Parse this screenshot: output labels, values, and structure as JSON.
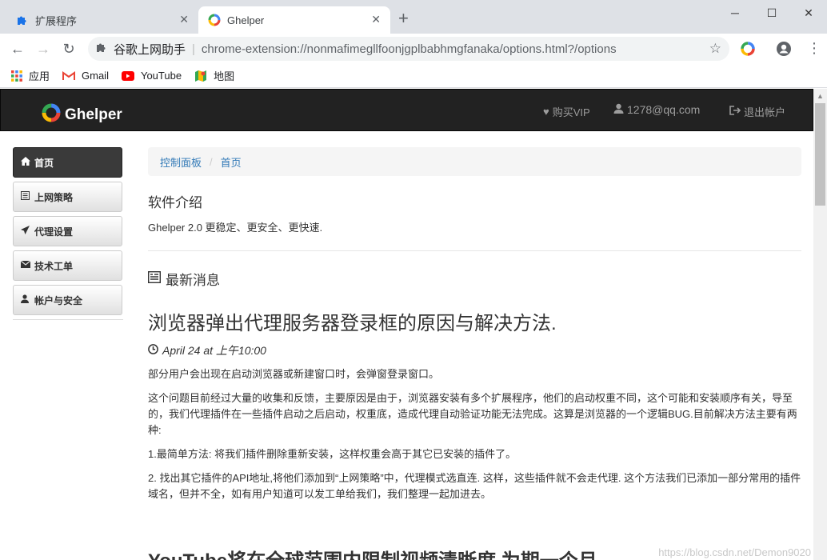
{
  "browser": {
    "tabs": [
      {
        "title": "扩展程序",
        "active": false
      },
      {
        "title": "Ghelper",
        "active": true
      }
    ],
    "omnibox": {
      "site_label": "谷歌上网助手",
      "url": "chrome-extension://nonmafimegllfoonjgplbabhmgfanaka/options.html?/options"
    },
    "bookmarks": [
      {
        "label": "应用",
        "icon": "apps-grid-icon"
      },
      {
        "label": "Gmail",
        "icon": "gmail-icon"
      },
      {
        "label": "YouTube",
        "icon": "youtube-icon"
      },
      {
        "label": "地图",
        "icon": "maps-icon"
      }
    ]
  },
  "navbar": {
    "brand": "Ghelper",
    "buy_vip": "购买VIP",
    "account": "1278@qq.com",
    "logout": "退出帐户"
  },
  "sidebar": {
    "items": [
      {
        "label": "首页",
        "icon": "home-icon",
        "active": true
      },
      {
        "label": "上网策略",
        "icon": "list-icon",
        "active": false
      },
      {
        "label": "代理设置",
        "icon": "send-icon",
        "active": false
      },
      {
        "label": "技术工单",
        "icon": "envelope-icon",
        "active": false
      },
      {
        "label": "帐户与安全",
        "icon": "user-icon",
        "active": false
      }
    ]
  },
  "breadcrumb": [
    "控制面板",
    "首页"
  ],
  "intro": {
    "heading": "软件介绍",
    "text": "Ghelper 2.0 更稳定、更安全、更快速."
  },
  "news": {
    "heading": "最新消息",
    "articles": [
      {
        "title": "浏览器弹出代理服务器登录框的原因与解决方法.",
        "date": "April 24 at 上午10:00",
        "paragraphs": [
          "部分用户会出现在启动浏览器或新建窗口时，会弹窗登录窗口。",
          "这个问题目前经过大量的收集和反馈，主要原因是由于，浏览器安装有多个扩展程序，他们的启动权重不同，这个可能和安装顺序有关，导至的，我们代理插件在一些插件启动之后启动，权重底，造成代理自动验证功能无法完成。这算是浏览器的一个逻辑BUG.目前解决方法主要有两种:",
          "1.最简单方法: 将我们插件删除重新安装，这样权重会高于其它已安装的插件了。",
          "2. 找出其它插件的API地址,将他们添加到“上网策略”中，代理模式选直连. 这样，这些插件就不会走代理. 这个方法我们已添加一部分常用的插件域名，但并不全，如有用户知道可以发工单给我们，我们整理一起加进去。"
        ]
      },
      {
        "title": "YouTube将在全球范围内限制视频清晰度 为期一个月"
      }
    ]
  },
  "watermark": "https://blog.csdn.net/Demon9020"
}
